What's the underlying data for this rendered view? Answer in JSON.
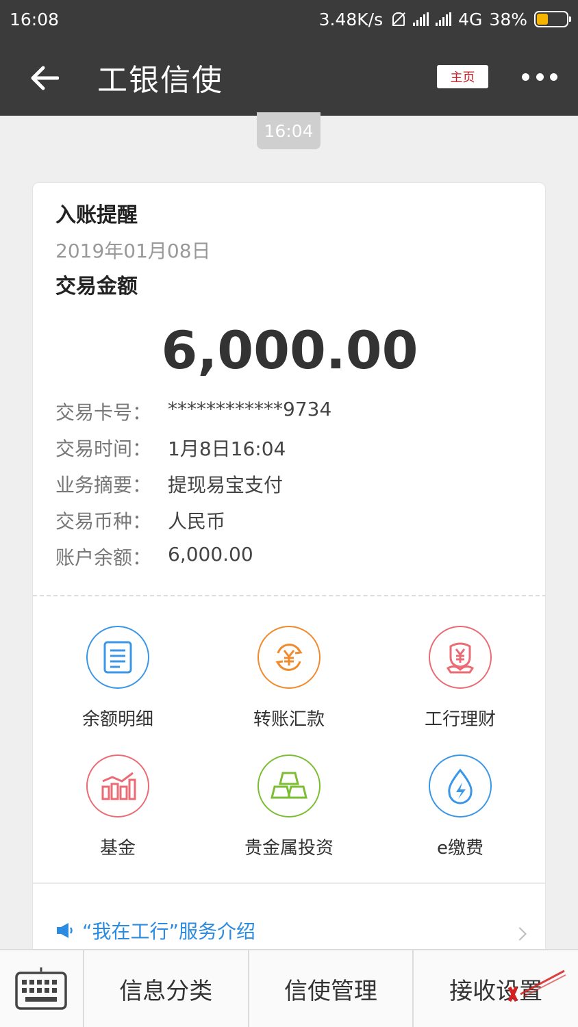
{
  "status_bar": {
    "time": "16:08",
    "net_speed": "3.48K/s",
    "network": "4G",
    "battery": "38%",
    "battery_level": 0.38
  },
  "app_bar": {
    "title": "工银信使",
    "home_label": "主页",
    "back_icon": "arrow-left-icon",
    "more_icon": "more-dots-icon"
  },
  "message": {
    "time": "16:04",
    "title": "入账提醒",
    "date": "2019年01月08日",
    "amount_label": "交易金额",
    "amount": "6,000.00",
    "details": [
      {
        "key": "交易卡号：",
        "value": "************9734"
      },
      {
        "key": "交易时间：",
        "value": "1月8日16:04"
      },
      {
        "key": "业务摘要：",
        "value": "提现易宝支付"
      },
      {
        "key": "交易币种：",
        "value": "人民币"
      },
      {
        "key": "账户余额：",
        "value": "6,000.00"
      }
    ],
    "services": [
      {
        "label": "余额明细",
        "icon": "document-icon",
        "color": "#3a96e6"
      },
      {
        "label": "转账汇款",
        "icon": "yuan-transfer-icon",
        "color": "#f08a2c"
      },
      {
        "label": "工行理财",
        "icon": "yuan-flower-icon",
        "color": "#ea6b74"
      },
      {
        "label": "基金",
        "icon": "bar-chart-icon",
        "color": "#ea6b74"
      },
      {
        "label": "贵金属投资",
        "icon": "gold-bars-icon",
        "color": "#7cbd33"
      },
      {
        "label": "e缴费",
        "icon": "water-drop-icon",
        "color": "#3a96e6"
      }
    ],
    "intro_link": "“我在工行”服务介绍"
  },
  "bottom_bar": {
    "keyboard_icon": "keyboard-icon",
    "menu": [
      "信息分类",
      "信使管理",
      "接收设置"
    ]
  }
}
